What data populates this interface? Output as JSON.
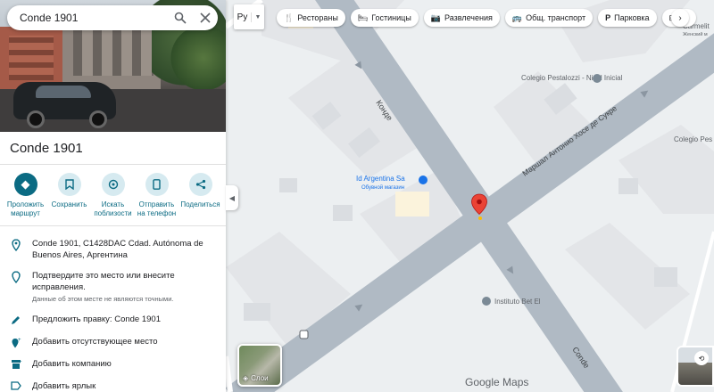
{
  "search": {
    "query": "Conde 1901"
  },
  "place": {
    "title": "Conde 1901"
  },
  "actions": [
    {
      "name": "directions-button",
      "label": "Проложить маршрут",
      "icon": "◆"
    },
    {
      "name": "save-button",
      "label": "Сохранить",
      "icon": "▯"
    },
    {
      "name": "nearby-button",
      "label": "Искать поблизости",
      "icon": "◎"
    },
    {
      "name": "send-to-phone-button",
      "label": "Отправить на телефон",
      "icon": "▮"
    },
    {
      "name": "share-button",
      "label": "Поделиться",
      "icon": "<"
    }
  ],
  "info": {
    "address": "Conde 1901, C1428DAC Cdad. Autónoma de Buenos Aires, Аргентина",
    "confirm": "Подтвердите это место или внесите исправления.",
    "confirm_note": "Данные об этом месте не являются точными.",
    "suggest_edit": "Предложить правку: Conde 1901",
    "add_missing": "Добавить отсутствующее место",
    "add_business": "Добавить компанию",
    "add_label": "Добавить ярлык"
  },
  "map": {
    "lang": "Ру",
    "chips": [
      {
        "icon": "🍴",
        "label": "Рестораны"
      },
      {
        "icon": "🛏",
        "label": "Гостиницы"
      },
      {
        "icon": "📷",
        "label": "Развлечения"
      },
      {
        "icon": "🚌",
        "label": "Общ. транспорт"
      },
      {
        "icon": "P",
        "label": "Парковка"
      },
      {
        "icon": "⊞",
        "label": "Ап"
      }
    ],
    "street_conde": "Конде",
    "street_conde_lower": "Conde",
    "street_sucre": "Маршал Антонио Хосе де Сукре",
    "poi_pestalozzi": "Colegio Pestalozzi - Nivel Inicial",
    "poi_pestalozzi2": "Colegio Pes",
    "poi_argentina": "Id Argentina Sa",
    "poi_argentina_sub": "Обувной магазин",
    "poi_betel": "Instituto Bet El",
    "poi_carmelita": "Carmelit",
    "poi_carmelita_sub": "Женский м",
    "layers_label": "Слои",
    "google": "Google",
    "maps": "Maps"
  }
}
